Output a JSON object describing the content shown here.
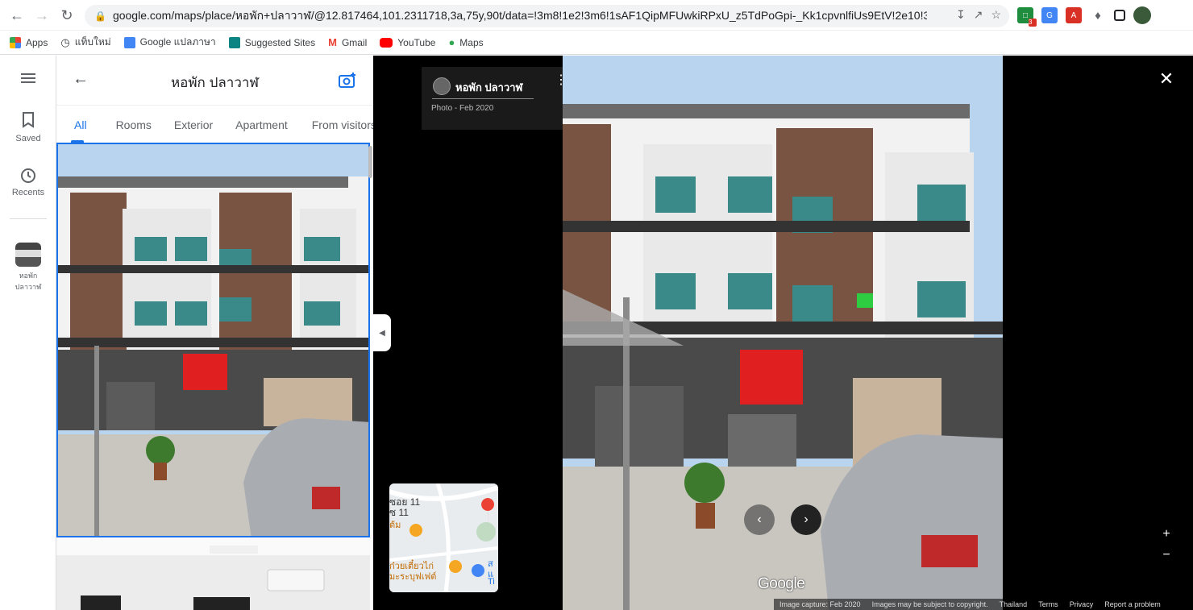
{
  "browser": {
    "url": "google.com/maps/place/หอพัก+ปลาวาฬ/@12.817464,101.2311718,3a,75y,90t/data=!3m8!1e2!3m6!1sAF1QipMFUwkiRPxU_z5TdPoGpi-_Kk1cpvnlfiUs9EtV!2e10!3e12!6shtt...",
    "ext_badge": "3"
  },
  "bookmarks": [
    {
      "label": "Apps",
      "icon": "apps-grid-icon"
    },
    {
      "label": "แท็บใหม่",
      "icon": "history-icon"
    },
    {
      "label": "Google แปลภาษา",
      "icon": "google-translate-icon"
    },
    {
      "label": "Suggested Sites",
      "icon": "bing-icon"
    },
    {
      "label": "Gmail",
      "icon": "gmail-icon"
    },
    {
      "label": "YouTube",
      "icon": "youtube-icon"
    },
    {
      "label": "Maps",
      "icon": "maps-pin-icon"
    }
  ],
  "rail": {
    "saved": "Saved",
    "recents": "Recents",
    "place_line1": "หอพัก",
    "place_line2": "ปลาวาฬ"
  },
  "panel": {
    "title": "หอพัก ปลาวาฬ",
    "tabs": [
      "All",
      "Rooms",
      "Exterior",
      "Apartment",
      "From visitors"
    ]
  },
  "viewer": {
    "author": "หอพัก ปลาวาฬ",
    "date": "Photo - Feb 2020",
    "minimap_labels": [
      "ซอย 11",
      "ซ 11",
      "ต้ม",
      "ก๋วยเตี๋ยวไก่",
      "มะระบุฟเฟต์",
      "ส",
      "แ",
      "Ti"
    ],
    "google": "Google",
    "footer": [
      "Image capture: Feb 2020",
      "Images may be subject to copyright.",
      "Thailand",
      "Terms",
      "Privacy",
      "Report a problem"
    ],
    "zoom_in": "+",
    "zoom_out": "−"
  },
  "colors": {
    "accent": "#1a73e8",
    "viewer_bg": "#000000",
    "wall": "#f2f2f2",
    "brown": "#7a5442",
    "sky": "#b8d4ee"
  }
}
